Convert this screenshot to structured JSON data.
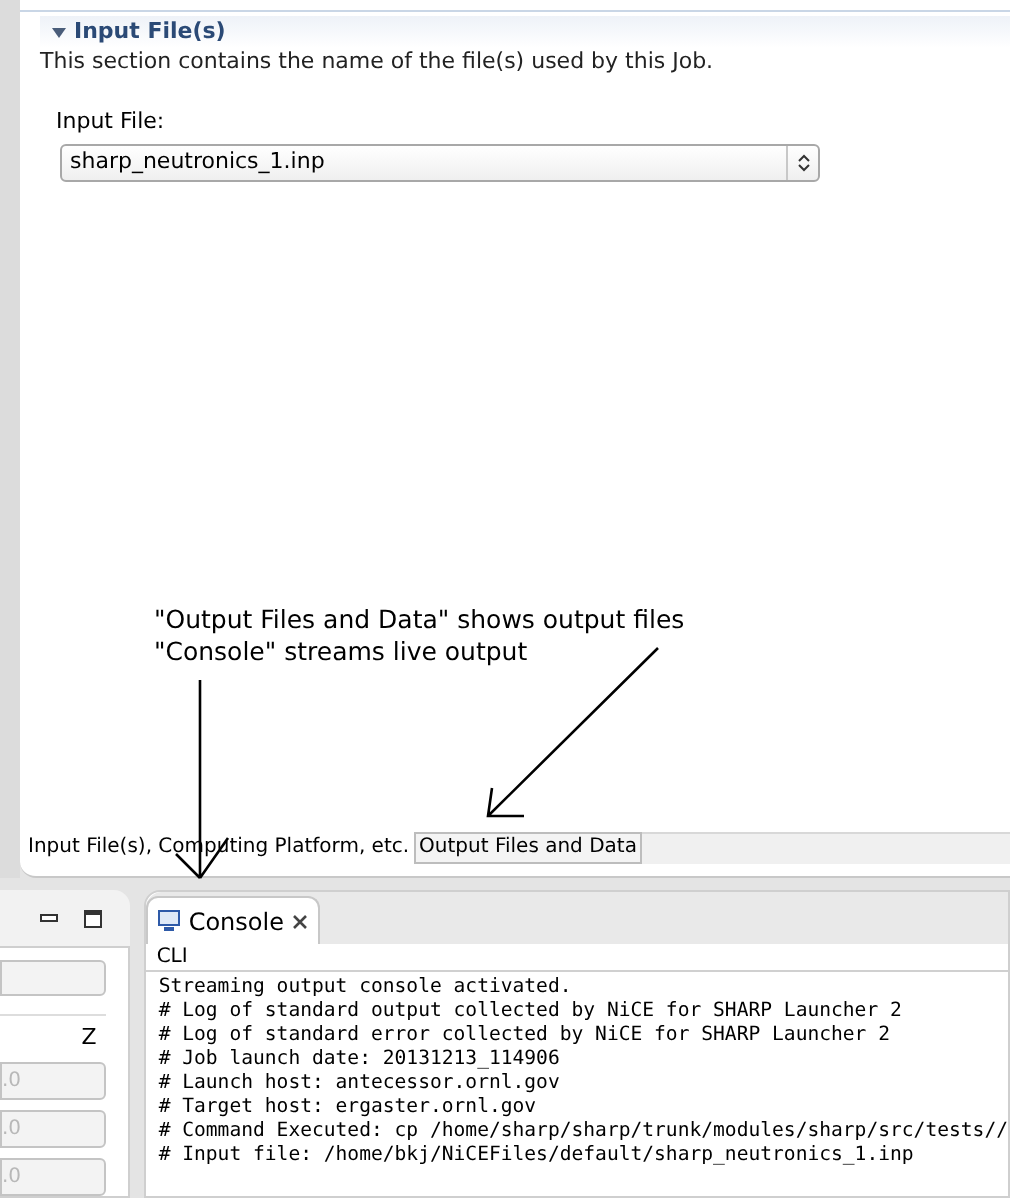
{
  "editor": {
    "section": {
      "title": "Input File(s)",
      "expanded": true,
      "description": "This section contains the name of the file(s) used by this Job."
    },
    "input_file": {
      "label": "Input File:",
      "value": "sharp_neutronics_1.inp"
    },
    "tabs": [
      {
        "label": "Input File(s), Computing Platform, etc.",
        "selected": true
      },
      {
        "label": "Output Files and Data",
        "selected": false
      }
    ]
  },
  "annotation": {
    "lines": [
      "\"Output Files and Data\" shows output files",
      "\"Console\" streams live output"
    ]
  },
  "left_panel": {
    "column_label": "Z",
    "fields": [
      {
        "value": ".0",
        "disabled": true
      },
      {
        "value": ".0",
        "disabled": true
      },
      {
        "value": ".0",
        "disabled": true
      }
    ]
  },
  "console": {
    "tab": {
      "label": "Console",
      "selected": true
    },
    "name": "CLI",
    "lines": [
      "Streaming output console activated.",
      "# Log of standard output collected by NiCE for SHARP Launcher 2",
      "# Log of standard error collected by NiCE for SHARP Launcher 2",
      "# Job launch date: 20131213_114906",
      "# Launch host: antecessor.ornl.gov",
      "# Target host: ergaster.ornl.gov",
      "# Command Executed: cp /home/sharp/sharp/trunk/modules/sharp/src/tests//",
      "# Input file: /home/bkj/NiCEFiles/default/sharp_neutronics_1.inp"
    ]
  }
}
